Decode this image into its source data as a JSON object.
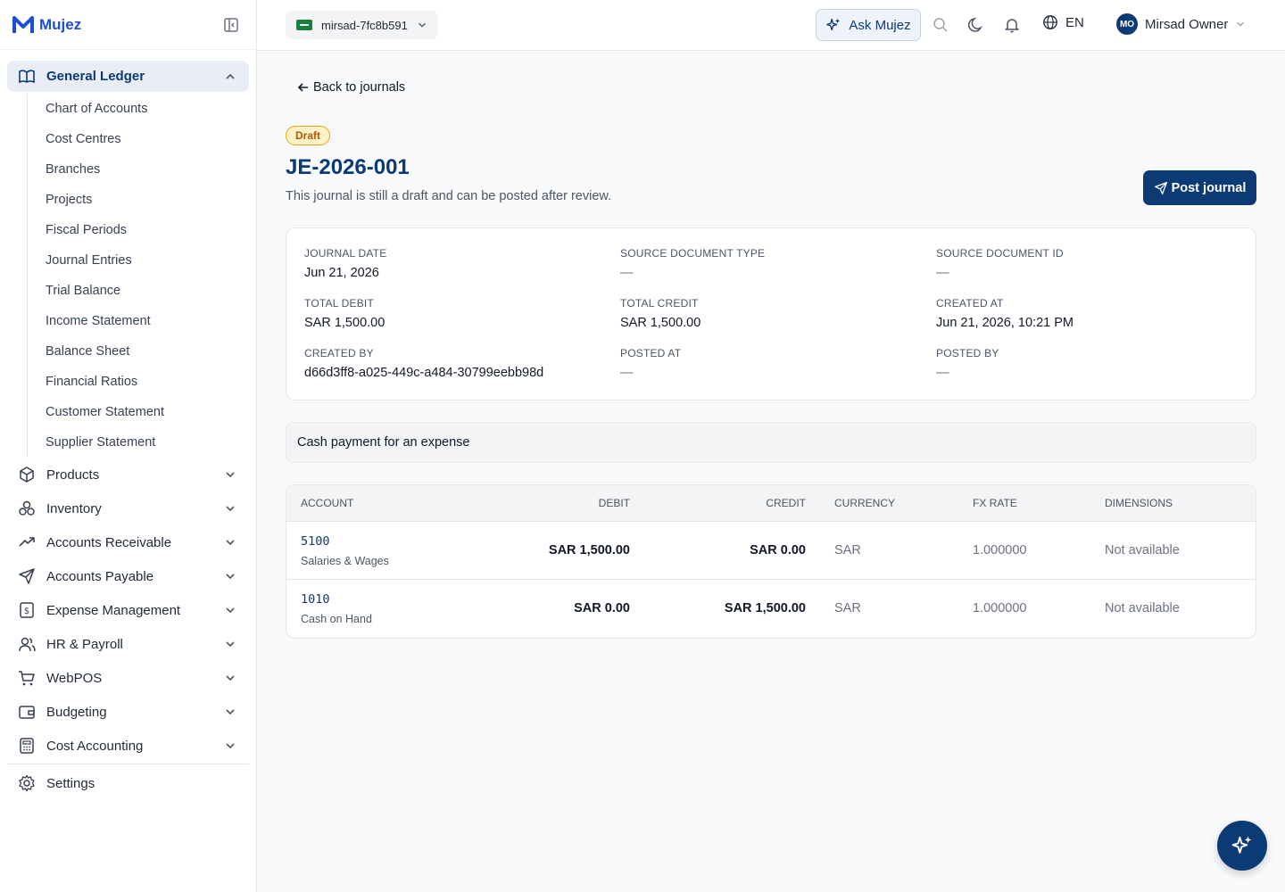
{
  "app": {
    "brand": "Mujez"
  },
  "sidebar": {
    "active_group": {
      "label": "General Ledger",
      "icon": "book-open-icon"
    },
    "subitems": [
      "Chart of Accounts",
      "Cost Centres",
      "Branches",
      "Projects",
      "Fiscal Periods",
      "Journal Entries",
      "Trial Balance",
      "Income Statement",
      "Balance Sheet",
      "Financial Ratios",
      "Customer Statement",
      "Supplier Statement"
    ],
    "groups": [
      {
        "label": "Products",
        "icon": "box-icon"
      },
      {
        "label": "Inventory",
        "icon": "boxes-icon"
      },
      {
        "label": "Accounts Receivable",
        "icon": "trending-up-icon"
      },
      {
        "label": "Accounts Payable",
        "icon": "send-icon"
      },
      {
        "label": "Expense Management",
        "icon": "receipt-icon"
      },
      {
        "label": "HR & Payroll",
        "icon": "users-icon"
      },
      {
        "label": "WebPOS",
        "icon": "cart-icon"
      },
      {
        "label": "Budgeting",
        "icon": "wallet-icon"
      },
      {
        "label": "Cost Accounting",
        "icon": "calculator-icon"
      }
    ],
    "settings": {
      "label": "Settings",
      "icon": "gear-icon"
    }
  },
  "topbar": {
    "tenant": "mirsad-7fc8b591",
    "ask_label": "Ask Mujez",
    "language": "EN",
    "user_initials": "MO",
    "user_name": "Mirsad Owner"
  },
  "journal": {
    "back_label": "Back to journals",
    "status": "Draft",
    "number": "JE-2026-001",
    "subtitle": "This journal is still a draft and can be posted after review.",
    "post_label": "Post journal",
    "fields": {
      "journal_date": {
        "label": "JOURNAL DATE",
        "value": "Jun 21, 2026"
      },
      "source_type": {
        "label": "SOURCE DOCUMENT TYPE",
        "value": "—"
      },
      "source_id": {
        "label": "SOURCE DOCUMENT ID",
        "value": "—"
      },
      "total_debit": {
        "label": "TOTAL DEBIT",
        "value": "SAR 1,500.00"
      },
      "total_credit": {
        "label": "TOTAL CREDIT",
        "value": "SAR 1,500.00"
      },
      "created_at": {
        "label": "CREATED AT",
        "value": "Jun 21, 2026, 10:21 PM"
      },
      "created_by": {
        "label": "CREATED BY",
        "value": "d66d3ff8-a025-449c-a484-30799eebb98d"
      },
      "posted_at": {
        "label": "POSTED AT",
        "value": "—"
      },
      "posted_by": {
        "label": "POSTED BY",
        "value": "—"
      }
    },
    "memo": "Cash payment for an expense",
    "columns": {
      "account": "ACCOUNT",
      "debit": "DEBIT",
      "credit": "CREDIT",
      "currency": "CURRENCY",
      "fx_rate": "FX RATE",
      "dimensions": "DIMENSIONS"
    },
    "lines": [
      {
        "code": "5100",
        "name": "Salaries & Wages",
        "debit": "SAR 1,500.00",
        "credit": "SAR 0.00",
        "currency": "SAR",
        "fx_rate": "1.000000",
        "dimensions": "Not available"
      },
      {
        "code": "1010",
        "name": "Cash on Hand",
        "debit": "SAR 0.00",
        "credit": "SAR 1,500.00",
        "currency": "SAR",
        "fx_rate": "1.000000",
        "dimensions": "Not available"
      }
    ]
  },
  "colors": {
    "brand": "#0b3a75",
    "draft_badge": "#f59e0b"
  }
}
